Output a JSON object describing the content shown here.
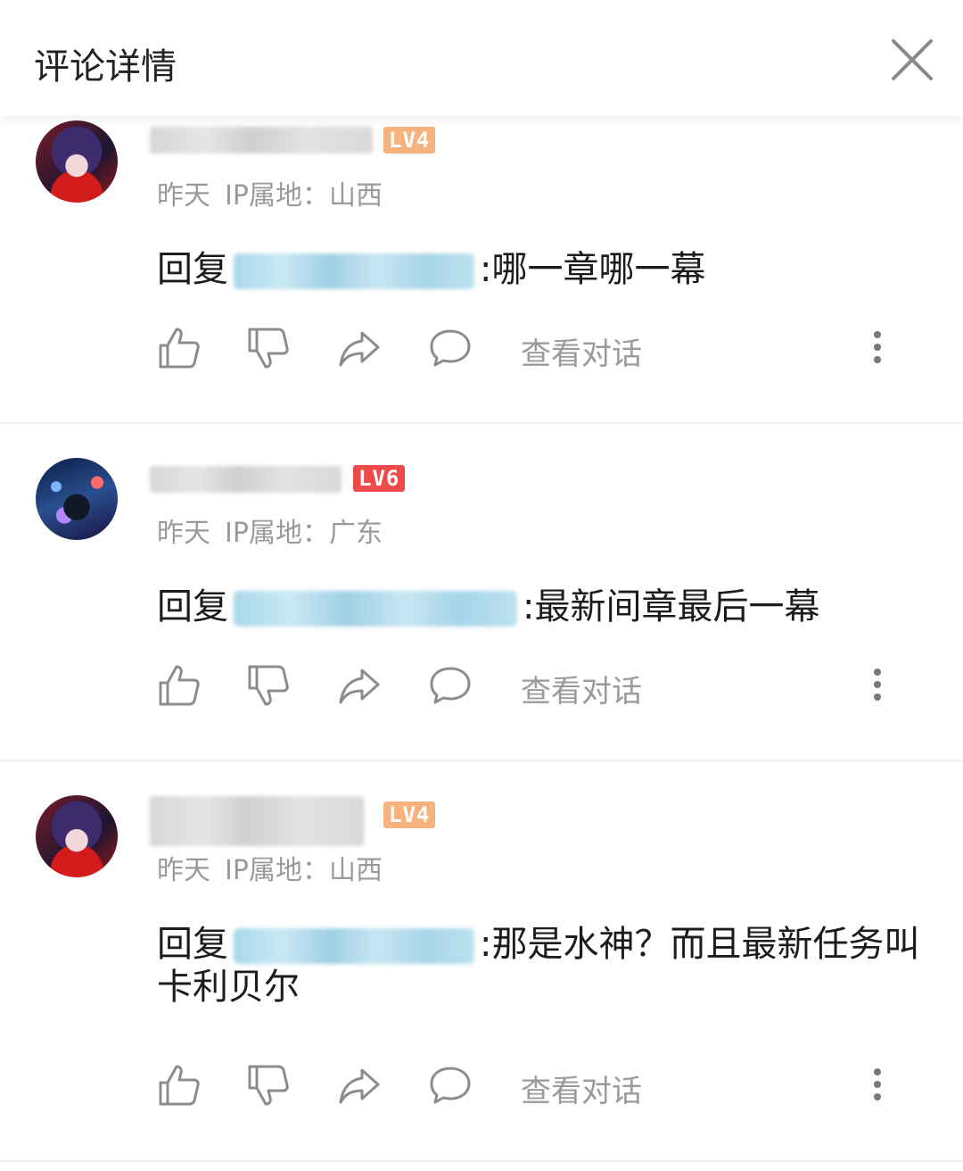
{
  "header": {
    "title": "评论详情",
    "close_icon": "close-icon"
  },
  "comments": [
    {
      "level": "LV4",
      "level_color": "#f7b27e",
      "time": "昨天",
      "ip_label": "IP属地：山西",
      "reply_prefix": "回复",
      "text": ":哪一章哪一幕",
      "view_conversation": "查看对话"
    },
    {
      "level": "LV6",
      "level_color": "#ee4a4a",
      "time": "昨天",
      "ip_label": "IP属地：广东",
      "reply_prefix": "回复",
      "text": ":最新间章最后一幕",
      "view_conversation": "查看对话"
    },
    {
      "level": "LV4",
      "level_color": "#f7b27e",
      "time": "昨天",
      "ip_label": "IP属地：山西",
      "reply_prefix": "回复",
      "text": ":那是水神？而且最新任务叫卡利贝尔",
      "view_conversation": "查看对话"
    }
  ],
  "icons": [
    "like-icon",
    "dislike-icon",
    "share-icon",
    "comment-icon",
    "more-icon"
  ]
}
